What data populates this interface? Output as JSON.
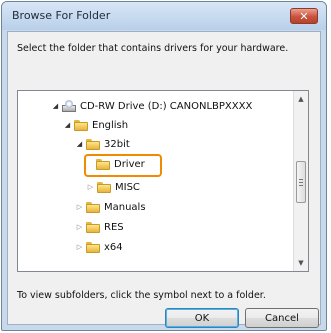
{
  "window": {
    "title": "Browse For Folder",
    "close_glyph": "✕"
  },
  "dialog": {
    "instruction": "Select the folder that contains drivers for your hardware.",
    "hint": "To view subfolders, click the symbol next to a folder."
  },
  "tree": {
    "nodes": [
      {
        "label": "CD-RW Drive (D:) CANONLBPXXXX",
        "icon": "cd-drive-icon",
        "state": "expanded"
      },
      {
        "label": "English",
        "icon": "folder-icon",
        "state": "expanded"
      },
      {
        "label": "32bit",
        "icon": "folder-icon",
        "state": "expanded"
      },
      {
        "label": "Driver",
        "icon": "folder-icon",
        "state": "selected"
      },
      {
        "label": "MISC",
        "icon": "folder-icon",
        "state": "collapsed"
      },
      {
        "label": "Manuals",
        "icon": "folder-icon",
        "state": "collapsed"
      },
      {
        "label": "RES",
        "icon": "folder-icon",
        "state": "collapsed"
      },
      {
        "label": "x64",
        "icon": "folder-icon",
        "state": "collapsed"
      }
    ]
  },
  "buttons": {
    "ok": "OK",
    "cancel": "Cancel"
  },
  "colors": {
    "highlight_border": "#f08a00",
    "close_button": "#c9533c",
    "titlebar": "#c9d9ec"
  }
}
